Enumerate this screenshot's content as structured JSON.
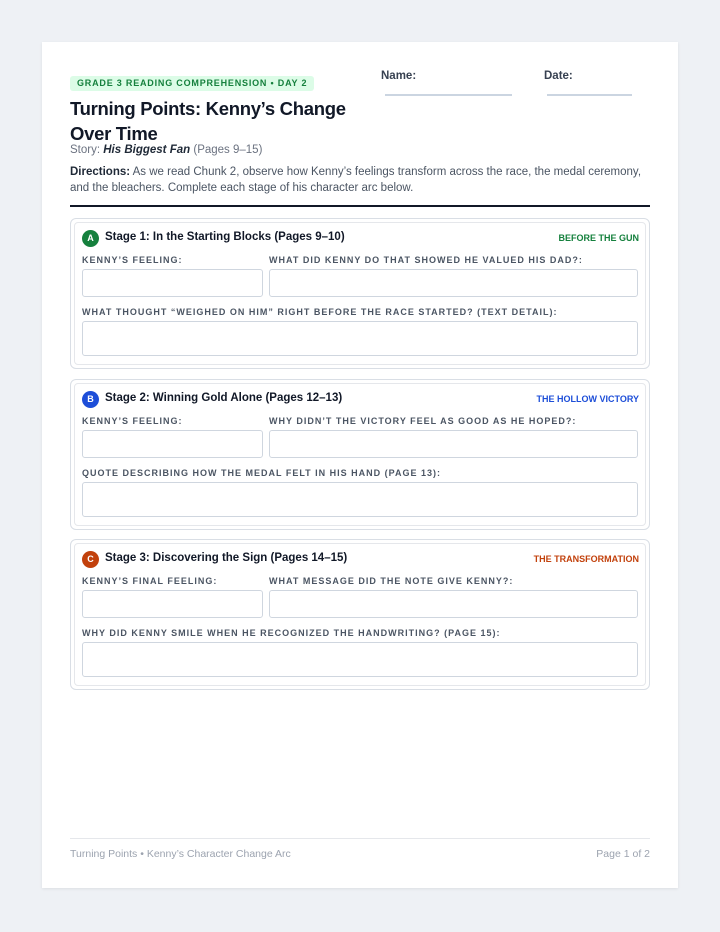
{
  "header": {
    "badge": "GRADE 3 READING COMPREHENSION • DAY 2",
    "title": "Turning Points: Kenny’s Change Over Time",
    "story_prefix": "Story:",
    "story_title": "His Biggest Fan",
    "story_pages": "(Pages 9–15)",
    "name_label": "Name:",
    "date_label": "Date:"
  },
  "directions": {
    "label": "Directions:",
    "text": "As we read Chunk 2, observe how Kenny’s feelings transform across the race, the medal ceremony, and the bleachers. Complete each stage of his character arc below."
  },
  "stages": [
    {
      "letter": "A",
      "heading": "Stage 1: In the Starting Blocks (Pages 9–10)",
      "tag": "BEFORE THE GUN",
      "color": "#15803d",
      "q1": "KENNY’S FEELING:",
      "q2": "WHAT DID KENNY DO THAT SHOWED HE VALUED HIS DAD?:",
      "q3": "WHAT THOUGHT “WEIGHED ON HIM” RIGHT BEFORE THE RACE STARTED? (TEXT DETAIL):"
    },
    {
      "letter": "B",
      "heading": "Stage 2: Winning Gold Alone (Pages 12–13)",
      "tag": "THE HOLLOW VICTORY",
      "color": "#1d4ed8",
      "q1": "KENNY’S FEELING:",
      "q2": "WHY DIDN’T THE VICTORY FEEL AS GOOD AS HE HOPED?:",
      "q3": "QUOTE DESCRIBING HOW THE MEDAL FELT IN HIS HAND (PAGE 13):"
    },
    {
      "letter": "C",
      "heading": "Stage 3: Discovering the Sign (Pages 14–15)",
      "tag": "THE TRANSFORMATION",
      "color": "#c2410c",
      "q1": "KENNY’S FINAL FEELING:",
      "q2": "WHAT MESSAGE DID THE NOTE GIVE KENNY?:",
      "q3": "WHY DID KENNY SMILE WHEN HE RECOGNIZED THE HANDWRITING? (PAGE 15):"
    }
  ],
  "footer": {
    "left": "Turning Points • Kenny’s Character Change Arc",
    "right": "Page 1 of 2"
  },
  "colors": {
    "badge_bg": "#dcfce7",
    "badge_text": "#15803d",
    "stage_a": "#15803d",
    "stage_b": "#1d4ed8",
    "stage_c": "#c2410c"
  }
}
